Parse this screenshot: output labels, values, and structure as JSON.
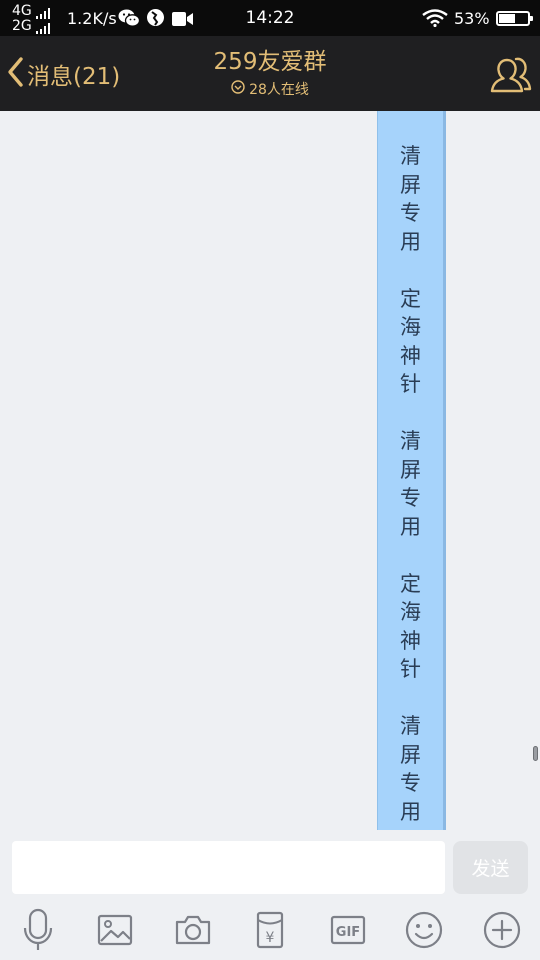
{
  "status_bar": {
    "network_top": "4G",
    "network_bottom": "2G",
    "speed": "1.2K/s",
    "time": "14:22",
    "battery_percent": "53%",
    "battery_level": 0.53,
    "icons": [
      "wechat-icon",
      "browser-icon",
      "video-camera-icon",
      "wifi-icon",
      "battery-icon"
    ]
  },
  "header": {
    "back_label": "消息(21)",
    "title": "259友爱群",
    "online": "28人在线",
    "icons": [
      "chevron-left-icon",
      "chevron-circle-down-icon",
      "group-members-icon"
    ]
  },
  "chat": {
    "message_text": "针\n\n清\n屏\n专\n用\n\n定\n海\n神\n针\n\n清\n屏\n专\n用\n\n定\n海\n神\n针\n\n清\n屏\n专\n用"
  },
  "input": {
    "value": "",
    "placeholder": "",
    "send_label": "发送"
  },
  "toolbar": {
    "gif_label": "GIF",
    "redpacket_symbol": "¥",
    "items": [
      "microphone-icon",
      "image-icon",
      "camera-icon",
      "red-packet-icon",
      "gif-icon",
      "emoji-icon",
      "plus-icon"
    ]
  },
  "colors": {
    "accent": "#e2bd76",
    "nav_bg": "#1f1f21",
    "status_bg": "#0b0b0b",
    "chat_bg": "#eef0f3",
    "bubble": "#a6d3fb",
    "icon_gray": "#7d8088"
  }
}
